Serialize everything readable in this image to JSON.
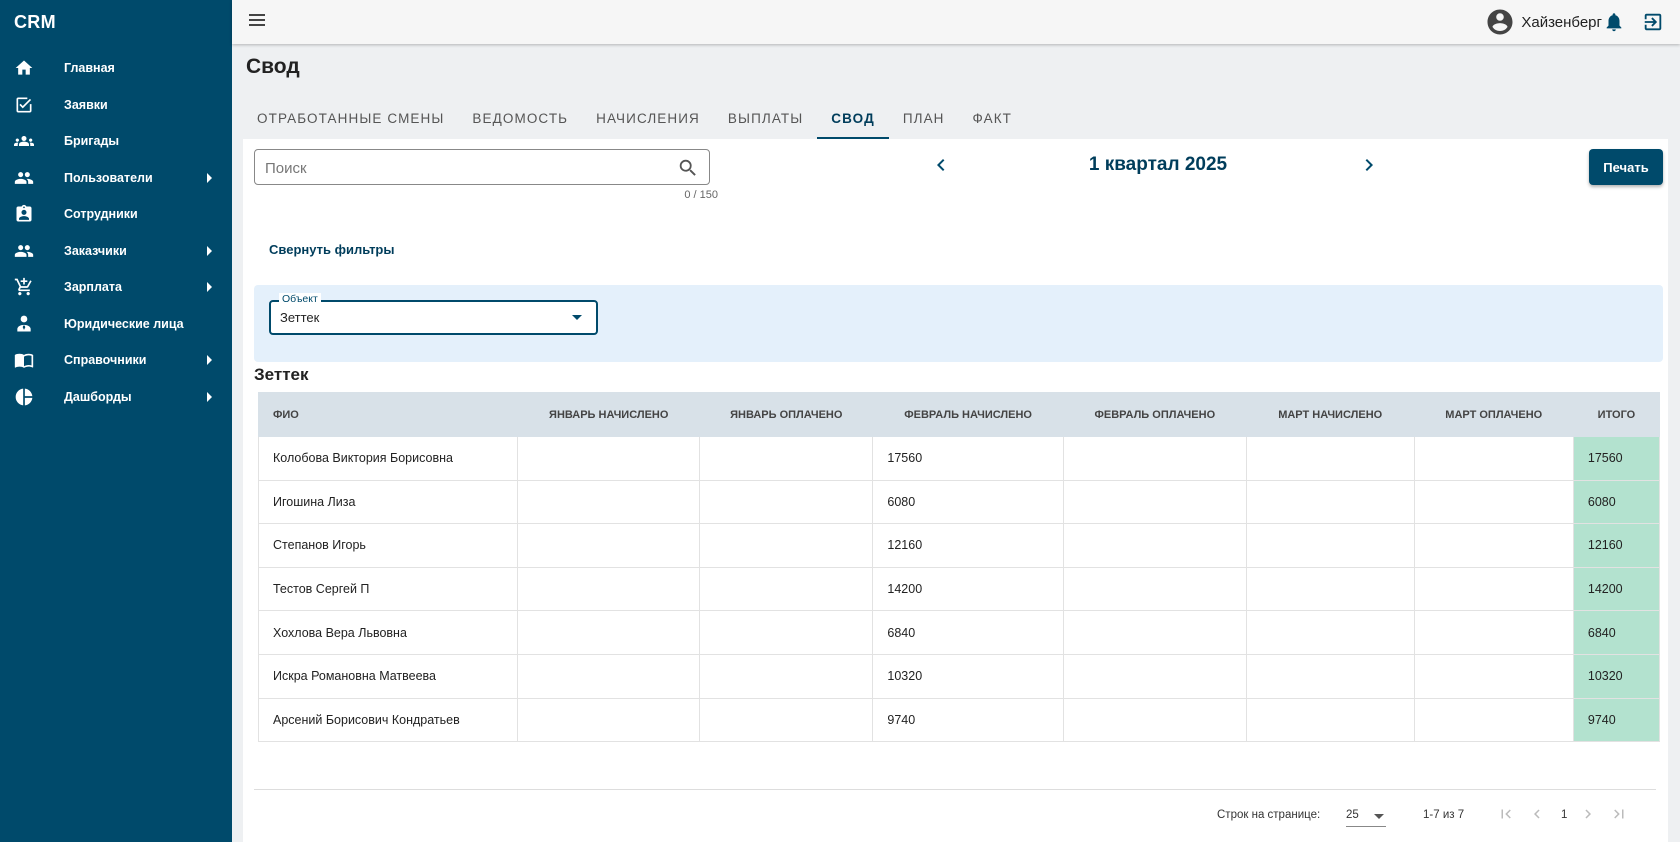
{
  "app": {
    "brand": "CRM"
  },
  "sidebar": {
    "items": [
      {
        "label": "Главная",
        "icon": "home-icon",
        "has_submenu": false
      },
      {
        "label": "Заявки",
        "icon": "checkbox-icon",
        "has_submenu": false
      },
      {
        "label": "Бригады",
        "icon": "groups-icon",
        "has_submenu": false
      },
      {
        "label": "Пользователи",
        "icon": "people-icon",
        "has_submenu": true
      },
      {
        "label": "Сотрудники",
        "icon": "badge-icon",
        "has_submenu": false
      },
      {
        "label": "Заказчики",
        "icon": "people-icon",
        "has_submenu": true
      },
      {
        "label": "Зарплата",
        "icon": "cart-icon",
        "has_submenu": true
      },
      {
        "label": "Юридические лица",
        "icon": "person-tie-icon",
        "has_submenu": false
      },
      {
        "label": "Справочники",
        "icon": "book-icon",
        "has_submenu": true
      },
      {
        "label": "Дашборды",
        "icon": "pie-chart-icon",
        "has_submenu": true
      }
    ]
  },
  "topbar": {
    "user_name": "Хайзенберг"
  },
  "page": {
    "title": "Свод"
  },
  "tabs": [
    {
      "label": "ОТРАБОТАННЫЕ СМЕНЫ",
      "active": false
    },
    {
      "label": "ВЕДОМОСТЬ",
      "active": false
    },
    {
      "label": "НАЧИСЛЕНИЯ",
      "active": false
    },
    {
      "label": "ВЫПЛАТЫ",
      "active": false
    },
    {
      "label": "СВОД",
      "active": true
    },
    {
      "label": "ПЛАН",
      "active": false
    },
    {
      "label": "ФАКТ",
      "active": false
    }
  ],
  "search": {
    "placeholder": "Поиск",
    "value": "",
    "counter": "0 / 150"
  },
  "period": {
    "label": "1 квартал 2025"
  },
  "print_label": "Печать",
  "collapse_filters_label": "Свернуть фильтры",
  "filters": {
    "object_label": "Объект",
    "object_value": "Зеттек"
  },
  "group_title": "Зеттек",
  "table": {
    "headers": [
      "ФИО",
      "ЯНВАРЬ НАЧИСЛЕНО",
      "ЯНВАРЬ ОПЛАЧЕНО",
      "ФЕВРАЛЬ НАЧИСЛЕНО",
      "ФЕВРАЛЬ ОПЛАЧЕНО",
      "МАРТ НАЧИСЛЕНО",
      "МАРТ ОПЛАЧЕНО",
      "ИТОГО"
    ],
    "rows": [
      [
        "Колобова Виктория Борисовна",
        "",
        "",
        "17560",
        "",
        "",
        "",
        "17560"
      ],
      [
        "Игошина Лиза",
        "",
        "",
        "6080",
        "",
        "",
        "",
        "6080"
      ],
      [
        "Степанов Игорь",
        "",
        "",
        "12160",
        "",
        "",
        "",
        "12160"
      ],
      [
        "Тестов Сергей П",
        "",
        "",
        "14200",
        "",
        "",
        "",
        "14200"
      ],
      [
        "Хохлова Вера Львовна",
        "",
        "",
        "6840",
        "",
        "",
        "",
        "6840"
      ],
      [
        "Искра Романовна Матвеева",
        "",
        "",
        "10320",
        "",
        "",
        "",
        "10320"
      ],
      [
        "Арсений Борисович Кондратьев",
        "",
        "",
        "9740",
        "",
        "",
        "",
        "9740"
      ]
    ]
  },
  "pagination": {
    "rows_per_page_label": "Строк на странице:",
    "rows_per_page": "25",
    "range": "1-7 из 7",
    "page": "1"
  },
  "colors": {
    "sidebar": "#004a6b",
    "accent": "#004a6b",
    "total_cell": "#b3e2cf",
    "filter_panel": "#e4f0fb"
  }
}
